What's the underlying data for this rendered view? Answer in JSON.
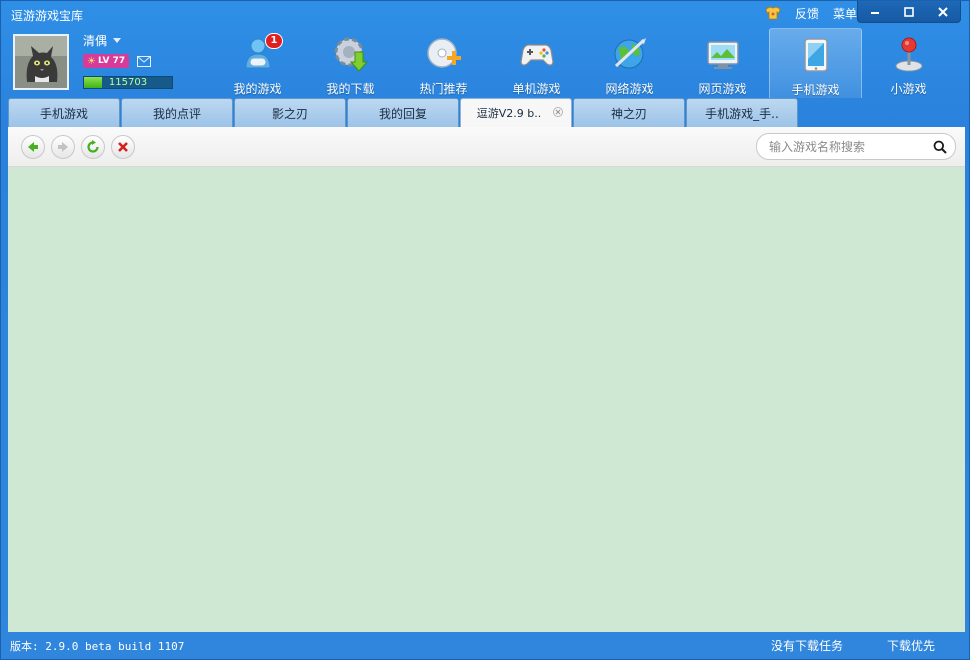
{
  "app": {
    "title": "逗游游戏宝库",
    "feedback_label": "反馈",
    "menu_label": "菜单"
  },
  "profile": {
    "username": "清偶",
    "level": "LV 77",
    "exp": "115703",
    "exp_progress": 0.2
  },
  "nav": {
    "items": [
      {
        "label": "我的游戏",
        "icon": "my-games-icon",
        "badge": "1"
      },
      {
        "label": "我的下载",
        "icon": "download-gear-icon"
      },
      {
        "label": "热门推荐",
        "icon": "hot-recommend-disc-icon"
      },
      {
        "label": "单机游戏",
        "icon": "gamepad-icon"
      },
      {
        "label": "网络游戏",
        "icon": "globe-icon"
      },
      {
        "label": "网页游戏",
        "icon": "web-game-icon"
      },
      {
        "label": "手机游戏",
        "icon": "mobile-phone-icon",
        "active": true
      },
      {
        "label": "小游戏",
        "icon": "joystick-icon"
      }
    ]
  },
  "tabs": [
    {
      "label": "手机游戏"
    },
    {
      "label": "我的点评"
    },
    {
      "label": "影之刃"
    },
    {
      "label": "我的回复"
    },
    {
      "label": "逗游V2.9 b..",
      "active": true
    },
    {
      "label": "神之刃"
    },
    {
      "label": "手机游戏_手.."
    }
  ],
  "search": {
    "placeholder": "输入游戏名称搜索",
    "value": ""
  },
  "status": {
    "version": "版本: 2.9.0 beta build 1107",
    "download_tasks": "没有下载任务",
    "download_priority": "下载优先"
  },
  "colors": {
    "chrome": "#2f86dc",
    "content_bg": "#cfe8d3",
    "badge": "#e02020"
  }
}
